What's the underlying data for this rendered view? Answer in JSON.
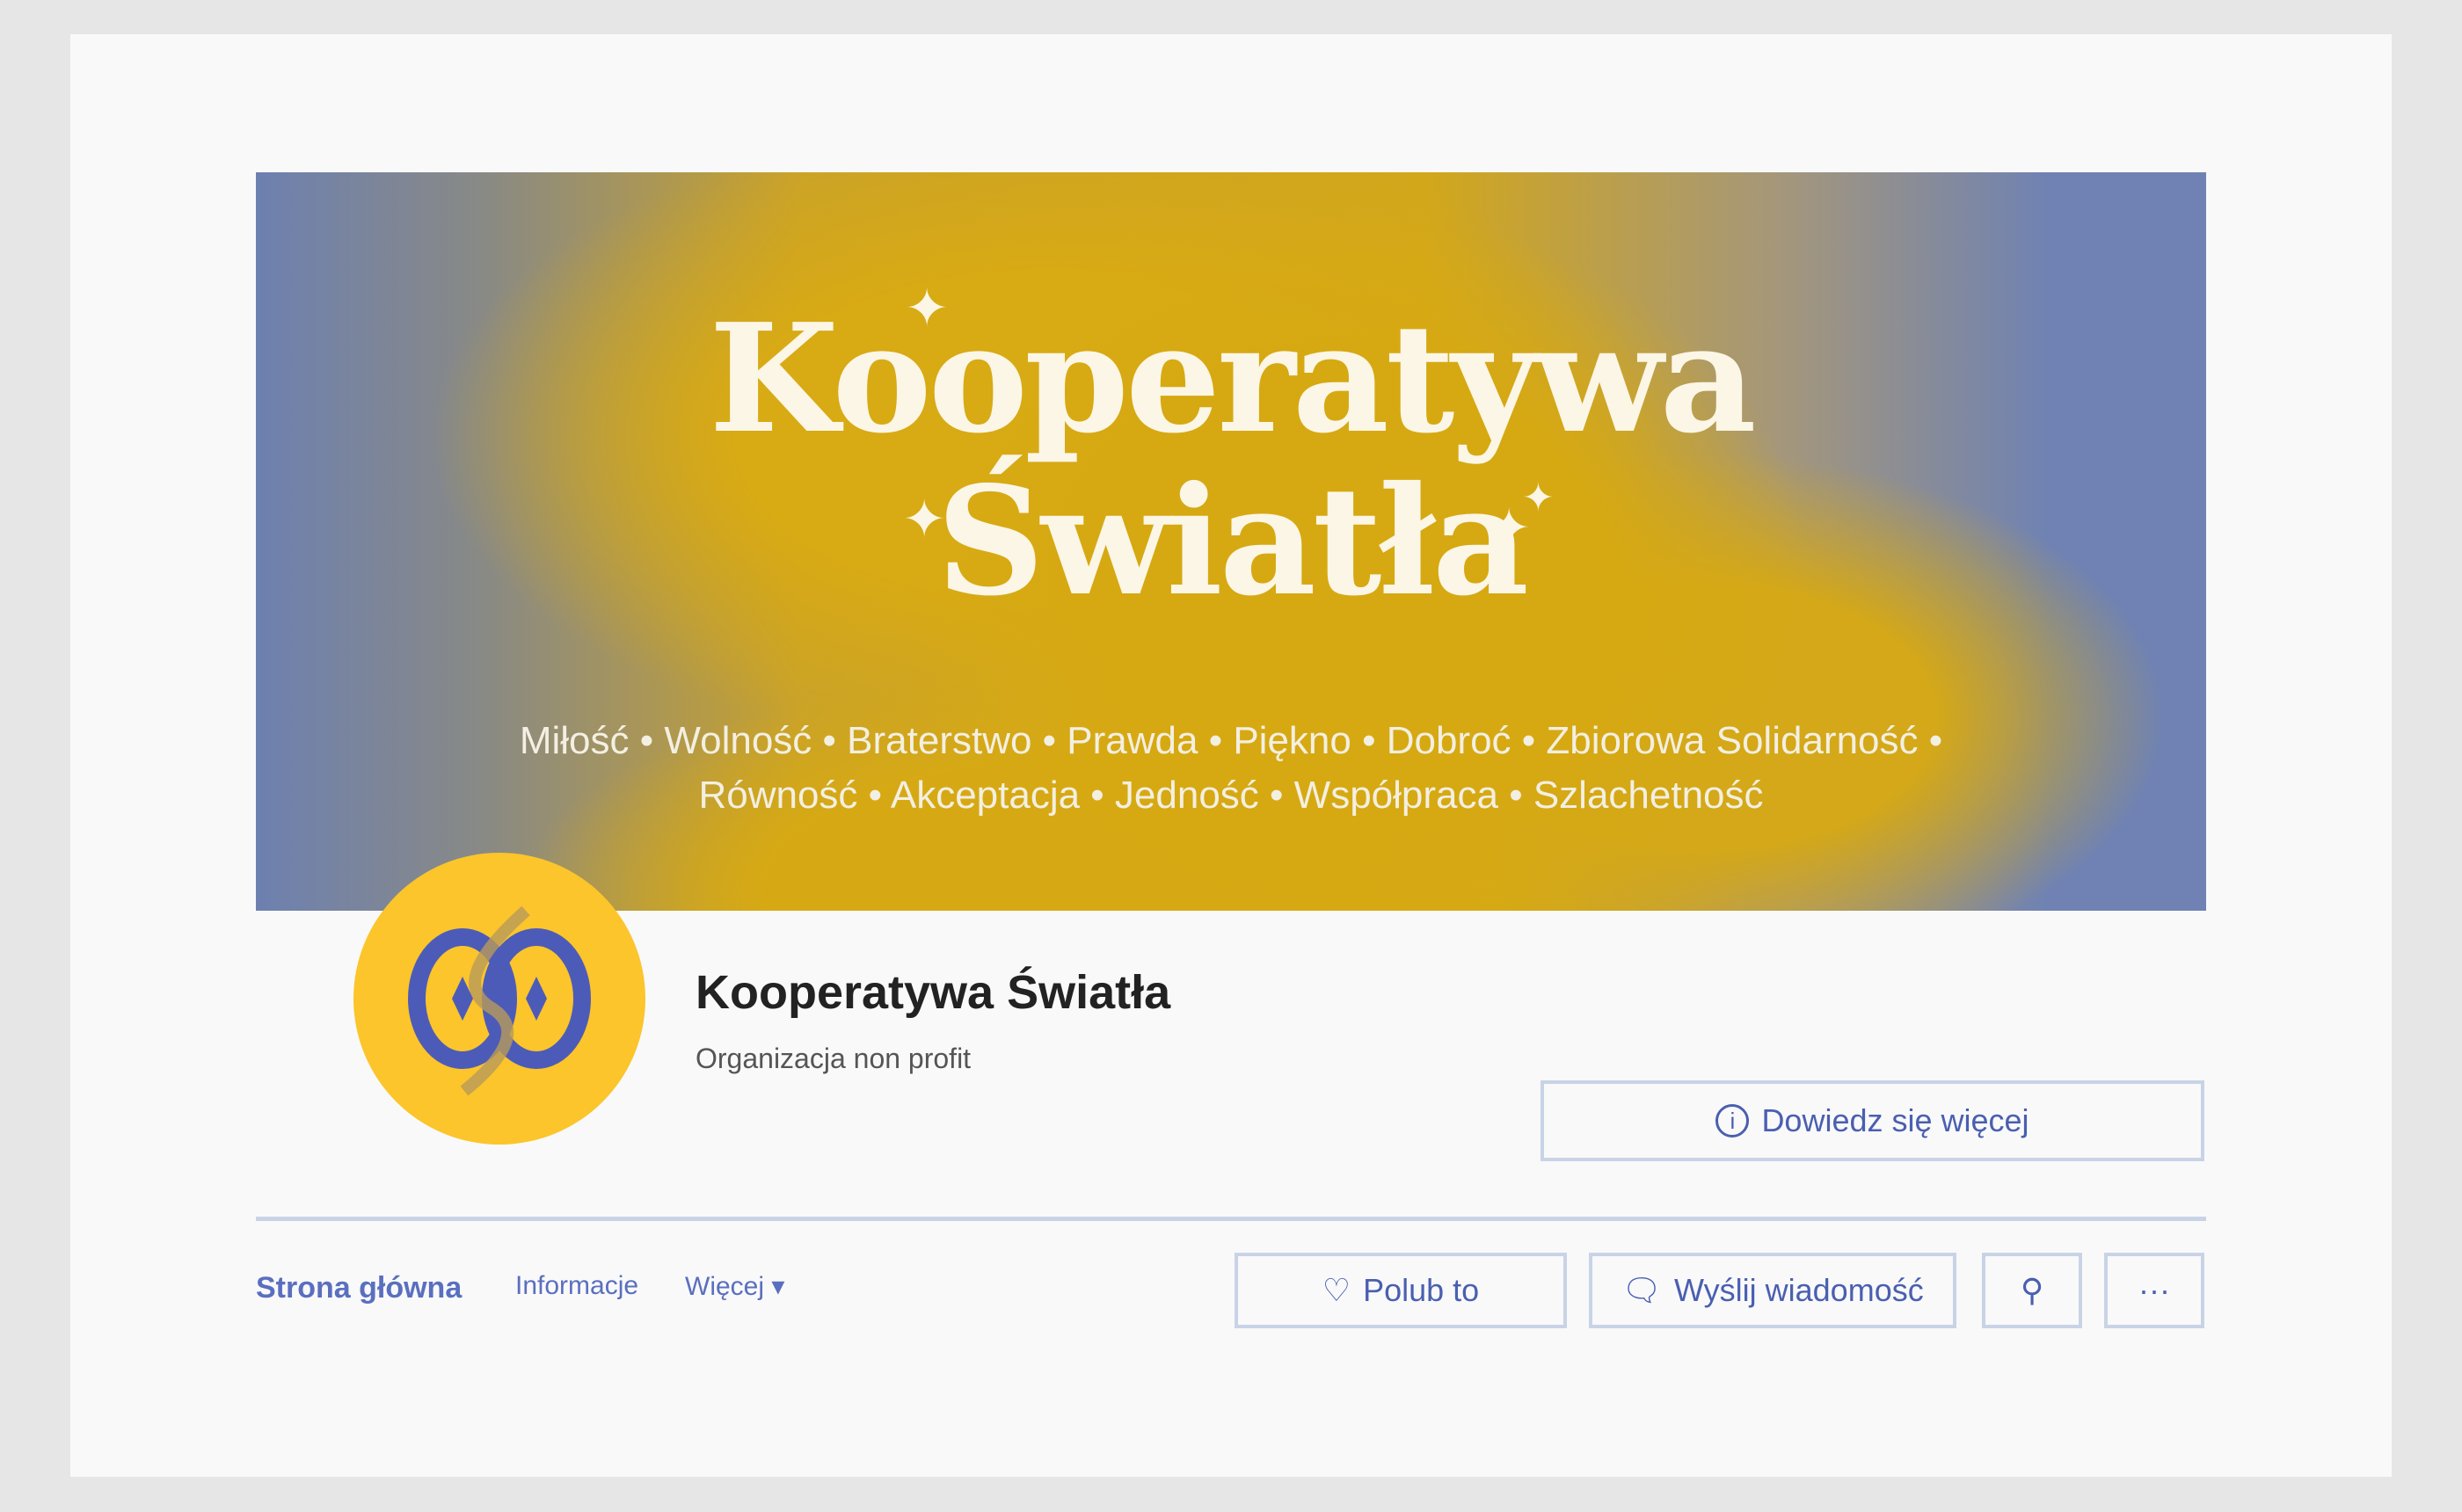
{
  "banner": {
    "title_line1": "Kooperatywa",
    "title_line2": "Światła",
    "values_line1": "Miłość • Wolność • Braterstwo • Prawda • Piękno • Dobroć • Zbiorowa Solidarność •",
    "values_line2": "Równość • Akceptacja • Jedność • Współpraca • Szlachetność"
  },
  "profile": {
    "name": "Kooperatywa Światła",
    "category": "Organizacja non profit",
    "learn_more": "Dowiedz się więcej"
  },
  "tabs": [
    {
      "label": "Strona główna"
    },
    {
      "label": "Informacje"
    },
    {
      "label": "Więcej ▾"
    }
  ],
  "actions": {
    "like": "Polub to",
    "message": "Wyślij wiadomość",
    "more": "···"
  },
  "colors": {
    "accent": "#4a5fb0",
    "yellow": "#fbc52b",
    "border": "#c9d3e6"
  }
}
